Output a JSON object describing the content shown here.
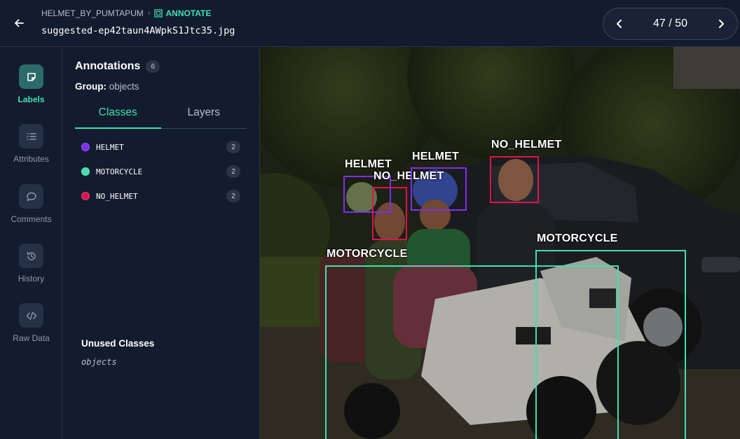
{
  "header": {
    "project": "HELMET_BY_PUMTAPUM",
    "mode": "ANNOTATE",
    "filename": "suggested-ep42taun4AWpkS1Jtc35.jpg",
    "pager": "47 / 50"
  },
  "rail": {
    "items": [
      {
        "label": "Labels",
        "icon": "tag-icon",
        "active": true
      },
      {
        "label": "Attributes",
        "icon": "list-icon",
        "active": false
      },
      {
        "label": "Comments",
        "icon": "chat-icon",
        "active": false
      },
      {
        "label": "History",
        "icon": "history-icon",
        "active": false
      },
      {
        "label": "Raw Data",
        "icon": "code-icon",
        "active": false
      }
    ]
  },
  "panel": {
    "title": "Annotations",
    "count": "6",
    "group_label": "Group:",
    "group_value": "objects",
    "tabs": [
      "Classes",
      "Layers"
    ],
    "classes": [
      {
        "name": "HELMET",
        "count": "2",
        "color": "#7b2ff2"
      },
      {
        "name": "MOTORCYCLE",
        "count": "2",
        "color": "#3fe0b0"
      },
      {
        "name": "NO_HELMET",
        "count": "2",
        "color": "#e0124e"
      }
    ],
    "unused_title": "Unused Classes",
    "unused_item": "objects"
  },
  "annotations": [
    {
      "label": "HELMET",
      "color": "#7b2ff2"
    },
    {
      "label": "NO_HELMET",
      "color": "#e0124e"
    },
    {
      "label": "HELMET",
      "color": "#7b2ff2"
    },
    {
      "label": "NO_HELMET",
      "color": "#e0124e"
    },
    {
      "label": "MOTORCYCLE",
      "color": "#3fe0b0"
    },
    {
      "label": "MOTORCYCLE",
      "color": "#3fe0b0"
    }
  ]
}
